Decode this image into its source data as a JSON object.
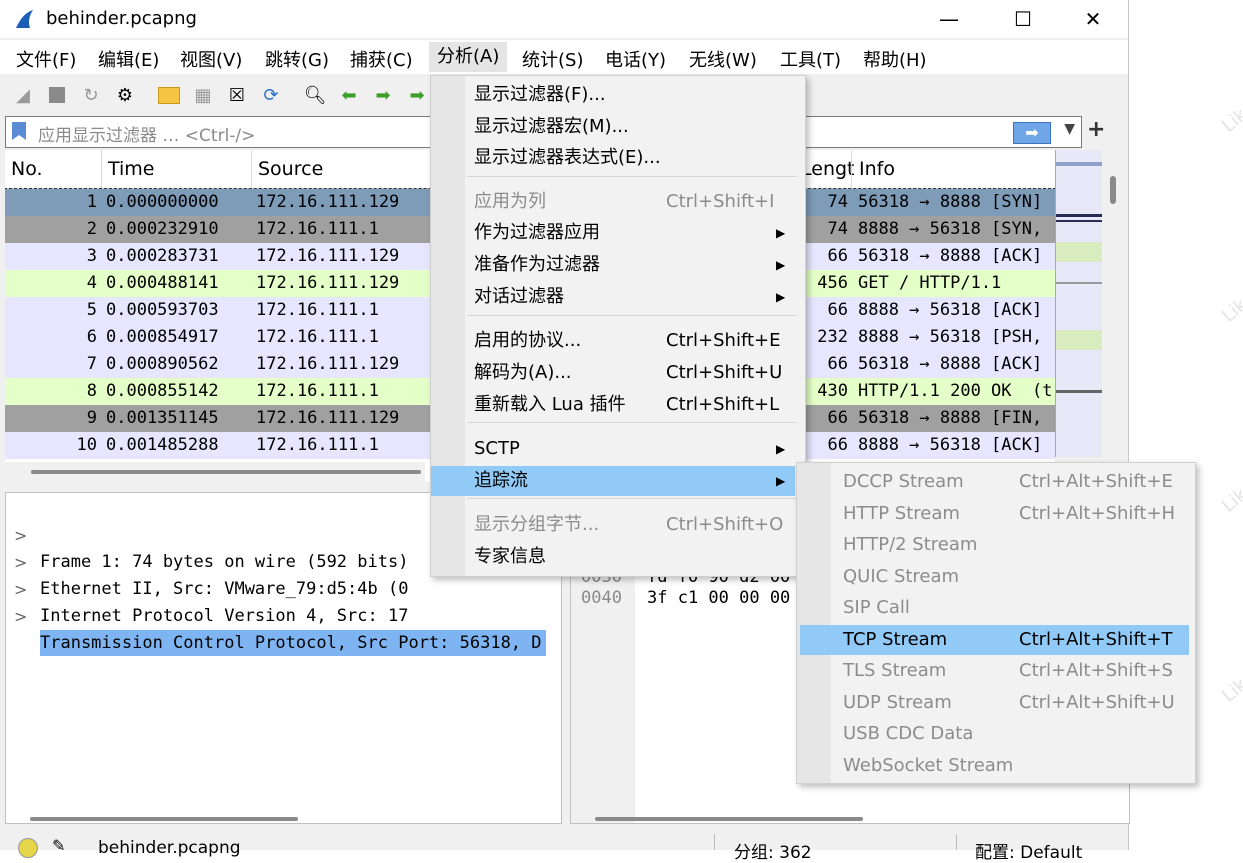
{
  "window": {
    "title": "behinder.pcapng",
    "minimize": "—",
    "maximize": "☐",
    "close": "✕"
  },
  "menubar": {
    "items": [
      "文件(F)",
      "编辑(E)",
      "视图(V)",
      "跳转(G)",
      "捕获(C)",
      "分析(A)",
      "统计(S)",
      "电话(Y)",
      "无线(W)",
      "工具(T)",
      "帮助(H)"
    ],
    "active_index": 5
  },
  "filter": {
    "placeholder": "应用显示过滤器 … <Ctrl-/>",
    "apply_icon": "arrow-right-icon",
    "add_label": "+"
  },
  "packet_list": {
    "columns": [
      "No.",
      "Time",
      "Source",
      "Lengt",
      "Info"
    ],
    "rows": [
      {
        "no": "1",
        "time": "0.000000000",
        "source": "172.16.111.129",
        "len": "74",
        "info": "56318 → 8888 [SYN]",
        "bg": "#7e9bb7",
        "fg": "#000000"
      },
      {
        "no": "2",
        "time": "0.000232910",
        "source": "172.16.111.1",
        "len": "74",
        "info": "8888 → 56318 [SYN,",
        "bg": "#a0a0a0",
        "fg": "#000000"
      },
      {
        "no": "3",
        "time": "0.000283731",
        "source": "172.16.111.129",
        "len": "66",
        "info": "56318 → 8888 [ACK]",
        "bg": "#e7e6ff",
        "fg": "#000000"
      },
      {
        "no": "4",
        "time": "0.000488141",
        "source": "172.16.111.129",
        "len": "456",
        "info": "GET / HTTP/1.1",
        "bg": "#e4ffc7",
        "fg": "#000000"
      },
      {
        "no": "5",
        "time": "0.000593703",
        "source": "172.16.111.1",
        "len": "66",
        "info": "8888 → 56318 [ACK]",
        "bg": "#e7e6ff",
        "fg": "#000000"
      },
      {
        "no": "6",
        "time": "0.000854917",
        "source": "172.16.111.1",
        "len": "232",
        "info": "8888 → 56318 [PSH,",
        "bg": "#e7e6ff",
        "fg": "#000000"
      },
      {
        "no": "7",
        "time": "0.000890562",
        "source": "172.16.111.129",
        "len": "66",
        "info": "56318 → 8888 [ACK]",
        "bg": "#e7e6ff",
        "fg": "#000000"
      },
      {
        "no": "8",
        "time": "0.000855142",
        "source": "172.16.111.1",
        "len": "430",
        "info": "HTTP/1.1 200 OK  (t",
        "bg": "#e4ffc7",
        "fg": "#000000"
      },
      {
        "no": "9",
        "time": "0.001351145",
        "source": "172.16.111.129",
        "len": "66",
        "info": "56318 → 8888 [FIN,",
        "bg": "#a0a0a0",
        "fg": "#000000"
      },
      {
        "no": "10",
        "time": "0.001485288",
        "source": "172.16.111.1",
        "len": "66",
        "info": "8888 → 56318 [ACK]",
        "bg": "#e7e6ff",
        "fg": "#000000"
      }
    ]
  },
  "details": {
    "rows": [
      {
        "arrow": ">",
        "text": "Frame 1: 74 bytes on wire (592 bits)"
      },
      {
        "arrow": ">",
        "text": "Ethernet II, Src: VMware_79:d5:4b (0"
      },
      {
        "arrow": ">",
        "text": "Internet Protocol Version 4, Src: 17"
      },
      {
        "arrow": ">",
        "text": "Transmission Control Protocol, Src Port: 56318, D"
      }
    ],
    "selected_index": 3
  },
  "hex": {
    "rows": [
      {
        "offset": "0030",
        "bytes": "fd f0 90 d2 00"
      },
      {
        "offset": "0040",
        "bytes": "3f c1 00 00 00"
      }
    ]
  },
  "statusbar": {
    "file": "behinder.pcapng",
    "packets": "分组: 362",
    "profile": "配置: Default"
  },
  "analyze_menu": {
    "items": [
      {
        "label": "显示过滤器(F)...",
        "shortcut": "",
        "submenu": false,
        "disabled": false
      },
      {
        "label": "显示过滤器宏(M)...",
        "shortcut": "",
        "submenu": false,
        "disabled": false
      },
      {
        "label": "显示过滤器表达式(E)...",
        "shortcut": "",
        "submenu": false,
        "disabled": false
      },
      {
        "label": "应用为列",
        "shortcut": "Ctrl+Shift+I",
        "submenu": false,
        "disabled": true
      },
      {
        "label": "作为过滤器应用",
        "shortcut": "",
        "submenu": true,
        "disabled": false
      },
      {
        "label": "准备作为过滤器",
        "shortcut": "",
        "submenu": true,
        "disabled": false
      },
      {
        "label": "对话过滤器",
        "shortcut": "",
        "submenu": true,
        "disabled": false
      },
      {
        "label": "启用的协议...",
        "shortcut": "Ctrl+Shift+E",
        "submenu": false,
        "disabled": false
      },
      {
        "label": "解码为(A)...",
        "shortcut": "Ctrl+Shift+U",
        "submenu": false,
        "disabled": false
      },
      {
        "label": "重新载入 Lua 插件",
        "shortcut": "Ctrl+Shift+L",
        "submenu": false,
        "disabled": false
      },
      {
        "label": "SCTP",
        "shortcut": "",
        "submenu": true,
        "disabled": false
      },
      {
        "label": "追踪流",
        "shortcut": "",
        "submenu": true,
        "disabled": false,
        "highlighted": true
      },
      {
        "label": "显示分组字节...",
        "shortcut": "Ctrl+Shift+O",
        "submenu": false,
        "disabled": true
      },
      {
        "label": "专家信息",
        "shortcut": "",
        "submenu": false,
        "disabled": false
      }
    ]
  },
  "follow_submenu": {
    "items": [
      {
        "label": "DCCP Stream",
        "shortcut": "Ctrl+Alt+Shift+E",
        "disabled": true
      },
      {
        "label": "HTTP Stream",
        "shortcut": "Ctrl+Alt+Shift+H",
        "disabled": true
      },
      {
        "label": "HTTP/2 Stream",
        "shortcut": "",
        "disabled": true
      },
      {
        "label": "QUIC Stream",
        "shortcut": "",
        "disabled": true
      },
      {
        "label": "SIP Call",
        "shortcut": "",
        "disabled": true
      },
      {
        "label": "TCP Stream",
        "shortcut": "Ctrl+Alt+Shift+T",
        "disabled": false,
        "highlighted": true
      },
      {
        "label": "TLS Stream",
        "shortcut": "Ctrl+Alt+Shift+S",
        "disabled": true
      },
      {
        "label": "UDP Stream",
        "shortcut": "Ctrl+Alt+Shift+U",
        "disabled": true
      },
      {
        "label": "USB CDC Data",
        "shortcut": "",
        "disabled": true
      },
      {
        "label": "WebSocket Stream",
        "shortcut": "",
        "disabled": true
      }
    ]
  },
  "colors": {
    "menu_highlight": "#91c9f7",
    "selection": "#7fb4f2"
  }
}
